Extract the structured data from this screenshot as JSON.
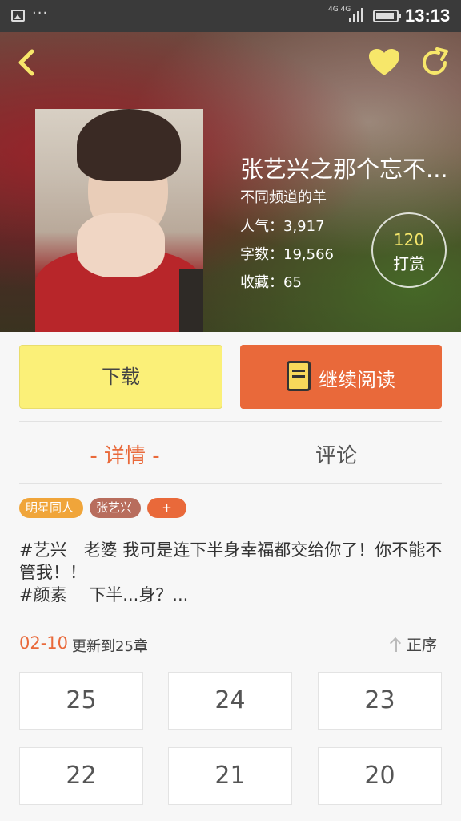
{
  "status_bar": {
    "time": "13:13",
    "network": "4G 4G"
  },
  "book": {
    "title": "张艺兴之那个忘不...",
    "author": "不同频道的羊",
    "popularity": "人气：3,917",
    "word_count": "字数：19,566",
    "favorites": "收藏：65",
    "reward_count": "120",
    "reward_label": "打赏"
  },
  "actions": {
    "download_label": "下载",
    "continue_label": "继续阅读"
  },
  "tabs": {
    "detail": "- 详情 -",
    "comment": "评论"
  },
  "tags": [
    "明星同人",
    "张艺兴",
    "+"
  ],
  "description": {
    "line1": "#艺兴　老婆 我可是连下半身幸福都交给你了！你不能不管我！！",
    "line2": "#颜素　 下半...身？..."
  },
  "update": {
    "date": "02-10",
    "text": "更新到25章",
    "sort_label": "正序"
  },
  "chapters": [
    "25",
    "24",
    "23",
    "22",
    "21",
    "20"
  ],
  "colors": {
    "accent": "#e9693a",
    "download_bg": "#fbf078",
    "reward_number": "#f5e66b",
    "icon_yellow": "#f7e76a"
  }
}
